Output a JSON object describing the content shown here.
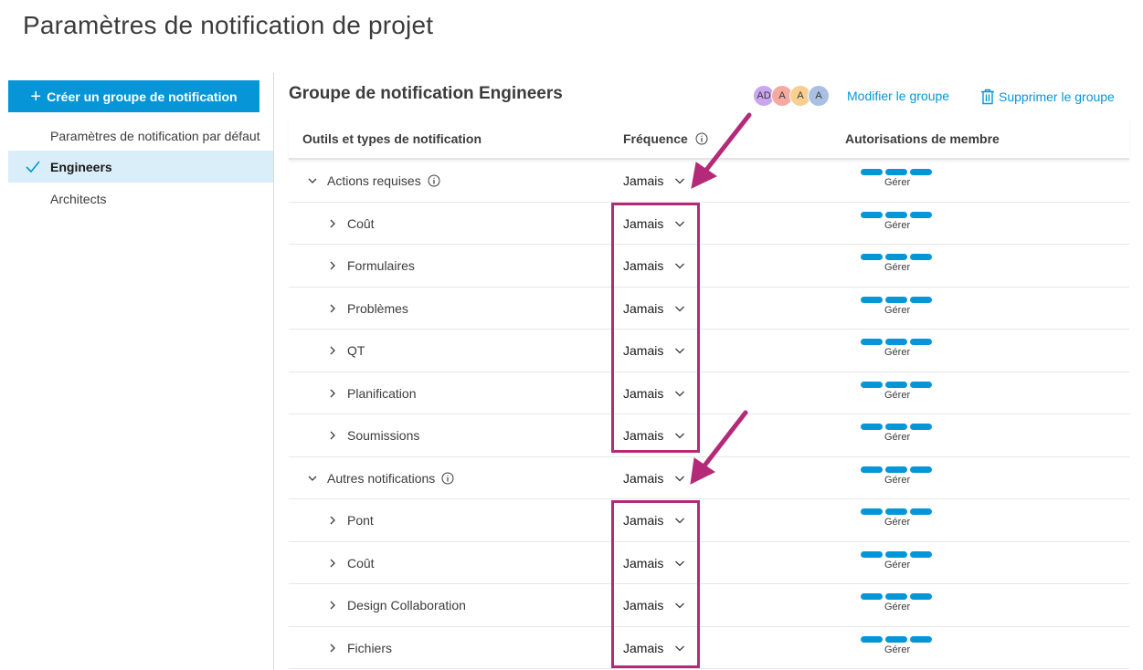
{
  "page": {
    "title": "Paramètres de notification de projet"
  },
  "sidebar": {
    "create_label": "Créer un groupe de notification",
    "items": [
      {
        "label": "Paramètres de notification par défaut",
        "active": false
      },
      {
        "label": "Engineers",
        "active": true
      },
      {
        "label": "Architects",
        "active": false
      }
    ]
  },
  "group": {
    "title": "Groupe de notification Engineers",
    "avatars": [
      {
        "initials": "AD",
        "color": "#c9a6ef"
      },
      {
        "initials": "A",
        "color": "#f5a9a0"
      },
      {
        "initials": "A",
        "color": "#f7cf8f"
      },
      {
        "initials": "A",
        "color": "#a9bfe4"
      }
    ],
    "edit_label": "Modifier le groupe",
    "delete_label": "Supprimer le groupe"
  },
  "table": {
    "headers": {
      "tools": "Outils et types de notification",
      "frequency": "Fréquence",
      "permissions": "Autorisations de membre"
    },
    "rows": [
      {
        "type": "section",
        "name": "Actions requises",
        "frequency": "Jamais",
        "permission": "Gérer"
      },
      {
        "type": "child",
        "name": "Coût",
        "frequency": "Jamais",
        "permission": "Gérer"
      },
      {
        "type": "child",
        "name": "Formulaires",
        "frequency": "Jamais",
        "permission": "Gérer"
      },
      {
        "type": "child",
        "name": "Problèmes",
        "frequency": "Jamais",
        "permission": "Gérer"
      },
      {
        "type": "child",
        "name": "QT",
        "frequency": "Jamais",
        "permission": "Gérer"
      },
      {
        "type": "child",
        "name": "Planification",
        "frequency": "Jamais",
        "permission": "Gérer"
      },
      {
        "type": "child",
        "name": "Soumissions",
        "frequency": "Jamais",
        "permission": "Gérer"
      },
      {
        "type": "section",
        "name": "Autres notifications",
        "frequency": "Jamais",
        "permission": "Gérer"
      },
      {
        "type": "child",
        "name": "Pont",
        "frequency": "Jamais",
        "permission": "Gérer"
      },
      {
        "type": "child",
        "name": "Coût",
        "frequency": "Jamais",
        "permission": "Gérer"
      },
      {
        "type": "child",
        "name": "Design Collaboration",
        "frequency": "Jamais",
        "permission": "Gérer"
      },
      {
        "type": "child",
        "name": "Fichiers",
        "frequency": "Jamais",
        "permission": "Gérer"
      }
    ]
  },
  "colors": {
    "accent": "#0696d7",
    "active_bg": "#d9eef8",
    "annotation": "#b52a78"
  }
}
